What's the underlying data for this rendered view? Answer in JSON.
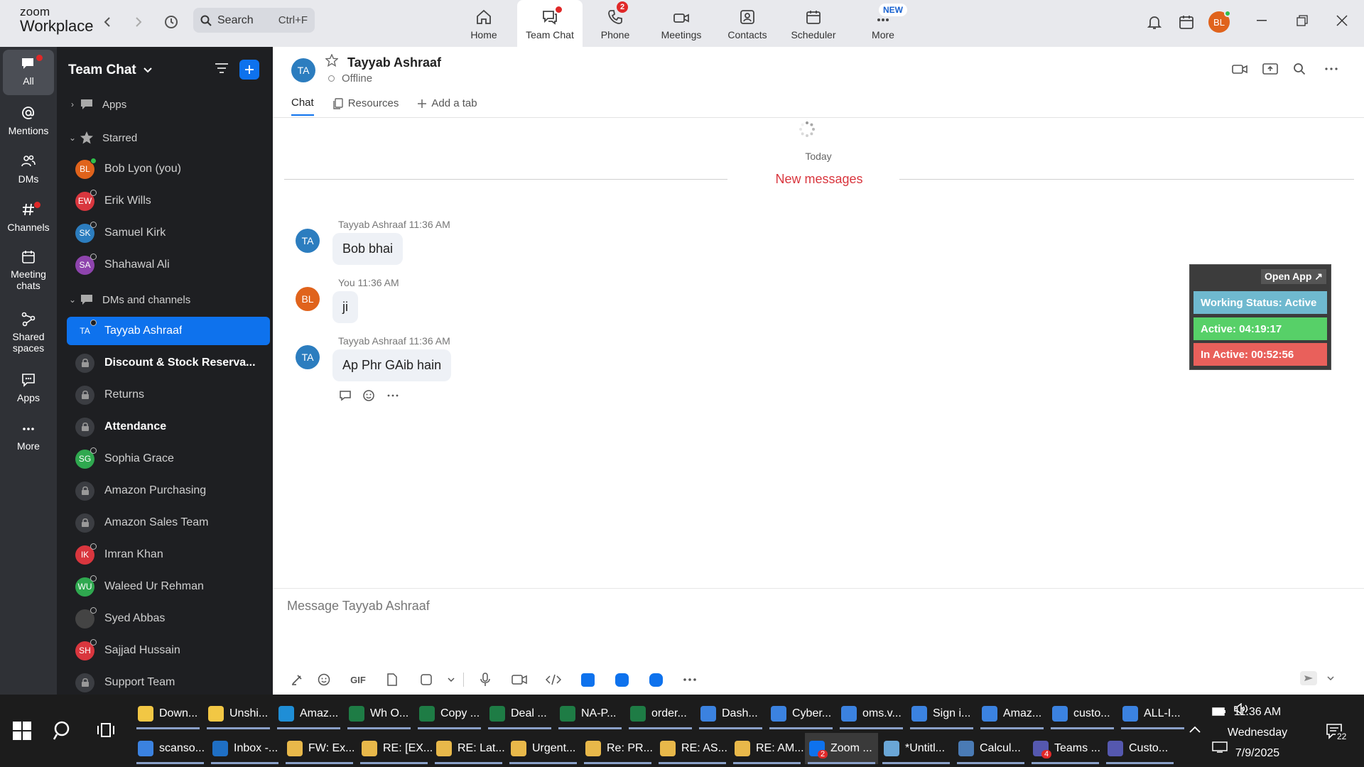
{
  "app": {
    "logo_line1": "zoom",
    "logo_line2": "Workplace",
    "search_placeholder": "Search",
    "search_shortcut": "Ctrl+F",
    "user_initials": "BL",
    "accent": "#0e72ed"
  },
  "nav_tabs": [
    {
      "label": "Home",
      "icon": "home-icon"
    },
    {
      "label": "Team Chat",
      "icon": "chat-icon",
      "active": true
    },
    {
      "label": "Phone",
      "icon": "phone-icon",
      "badge": "2"
    },
    {
      "label": "Meetings",
      "icon": "video-icon"
    },
    {
      "label": "Contacts",
      "icon": "contacts-icon"
    },
    {
      "label": "Scheduler",
      "icon": "calendar-icon"
    },
    {
      "label": "More",
      "icon": "more-icon",
      "tag": "NEW"
    }
  ],
  "rail": [
    {
      "label": "All",
      "icon": "chat-icon"
    },
    {
      "label": "Mentions",
      "icon": "at-icon"
    },
    {
      "label": "DMs",
      "icon": "people-icon"
    },
    {
      "label": "Channels",
      "icon": "hash-icon"
    },
    {
      "label": "Meeting chats",
      "icon": "calendar-icon"
    },
    {
      "label": "Shared spaces",
      "icon": "share-icon"
    },
    {
      "label": "Apps",
      "icon": "apps-icon"
    },
    {
      "label": "More",
      "icon": "more-icon"
    }
  ],
  "sidebar": {
    "title": "Team Chat",
    "sections": {
      "apps": "Apps",
      "starred": "Starred",
      "dms": "DMs and channels"
    },
    "starred": [
      {
        "initials": "BL",
        "name": "Bob Lyon (you)",
        "color": "#e0631c",
        "online": true
      },
      {
        "initials": "EW",
        "name": "Erik Wills",
        "color": "#d9363e"
      },
      {
        "initials": "SK",
        "name": "Samuel Kirk",
        "color": "#2c7dbf"
      },
      {
        "initials": "SA",
        "name": "Shahawal Ali",
        "color": "#8e44ad"
      }
    ],
    "items": [
      {
        "initials": "TA",
        "name": "Tayyab Ashraaf",
        "color": "#0e72ed",
        "selected": true
      },
      {
        "lock": true,
        "name": "Discount & Stock Reserva...",
        "bold": true
      },
      {
        "lock": true,
        "name": "Returns"
      },
      {
        "lock": true,
        "name": "Attendance",
        "bold": true
      },
      {
        "initials": "SG",
        "name": "Sophia Grace",
        "color": "#2fa84f"
      },
      {
        "lock": true,
        "name": "Amazon Purchasing"
      },
      {
        "lock": true,
        "name": "Amazon Sales Team"
      },
      {
        "initials": "IK",
        "name": "Imran Khan",
        "color": "#d9363e"
      },
      {
        "initials": "WU",
        "name": "Waleed Ur Rehman",
        "color": "#2fa84f"
      },
      {
        "initials": "",
        "name": "Syed Abbas",
        "color": "#444"
      },
      {
        "initials": "SH",
        "name": "Sajjad Hussain",
        "color": "#d9363e"
      },
      {
        "lock": true,
        "name": "Support Team"
      }
    ]
  },
  "chat": {
    "contact_initials": "TA",
    "contact_name": "Tayyab Ashraaf",
    "status": "Offline",
    "tabs": [
      "Chat",
      "Resources",
      "Add a tab"
    ],
    "date_divider": "Today",
    "new_messages": "New messages",
    "messages": [
      {
        "initials": "TA",
        "color": "#2c7dbf",
        "sender": "Tayyab Ashraaf",
        "time": "11:36 AM",
        "text": "Bob bhai"
      },
      {
        "initials": "BL",
        "color": "#e0631c",
        "sender": "You",
        "time": "11:36 AM",
        "text": "ji"
      },
      {
        "initials": "TA",
        "color": "#2c7dbf",
        "sender": "Tayyab Ashraaf",
        "time": "11:36 AM",
        "text": "Ap Phr GAib hain"
      }
    ],
    "composer_placeholder": "Message Tayyab Ashraaf"
  },
  "widget": {
    "open_label": "Open App ↗",
    "working_status": "Working Status: Active",
    "active": "Active: 04:19:17",
    "inactive": "In Active: 00:52:56"
  },
  "taskbar": {
    "row1": [
      {
        "label": "Down...",
        "color": "#f2c744"
      },
      {
        "label": "Unshi...",
        "color": "#f2c744"
      },
      {
        "label": "Amaz...",
        "color": "#1f8ed6"
      },
      {
        "label": "Wh O...",
        "color": "#1e7c45"
      },
      {
        "label": "Copy ...",
        "color": "#1e7c45"
      },
      {
        "label": "Deal ...",
        "color": "#1e7c45"
      },
      {
        "label": "NA-P...",
        "color": "#1e7c45"
      },
      {
        "label": "order...",
        "color": "#1e7c45"
      },
      {
        "label": "Dash...",
        "color": "#3b82e0"
      },
      {
        "label": "Cyber...",
        "color": "#3b82e0"
      },
      {
        "label": "oms.v...",
        "color": "#3b82e0"
      },
      {
        "label": "Sign i...",
        "color": "#3b82e0"
      },
      {
        "label": "Amaz...",
        "color": "#3b82e0"
      },
      {
        "label": "custo...",
        "color": "#3b82e0"
      },
      {
        "label": "ALL-I...",
        "color": "#3b82e0"
      }
    ],
    "row2": [
      {
        "label": "scanso...",
        "color": "#3b82e0"
      },
      {
        "label": "Inbox -...",
        "color": "#1f6fc4"
      },
      {
        "label": "FW: Ex...",
        "color": "#e8b84a"
      },
      {
        "label": "RE: [EX...",
        "color": "#e8b84a"
      },
      {
        "label": "RE: Lat...",
        "color": "#e8b84a"
      },
      {
        "label": "Urgent...",
        "color": "#e8b84a"
      },
      {
        "label": "Re: PR...",
        "color": "#e8b84a"
      },
      {
        "label": "RE: AS...",
        "color": "#e8b84a"
      },
      {
        "label": "RE: AM...",
        "color": "#e8b84a"
      },
      {
        "label": "Zoom ...",
        "color": "#0e72ed",
        "badge": "2",
        "active": true
      },
      {
        "label": "*Untitl...",
        "color": "#6aa6d6"
      },
      {
        "label": "Calcul...",
        "color": "#4a7bb5"
      },
      {
        "label": "Teams ...",
        "color": "#5558af",
        "badge": "4"
      },
      {
        "label": "Custo...",
        "color": "#5558af"
      }
    ],
    "time": "11:36 AM",
    "day": "Wednesday",
    "date": "7/9/2025",
    "notifications": "22"
  }
}
